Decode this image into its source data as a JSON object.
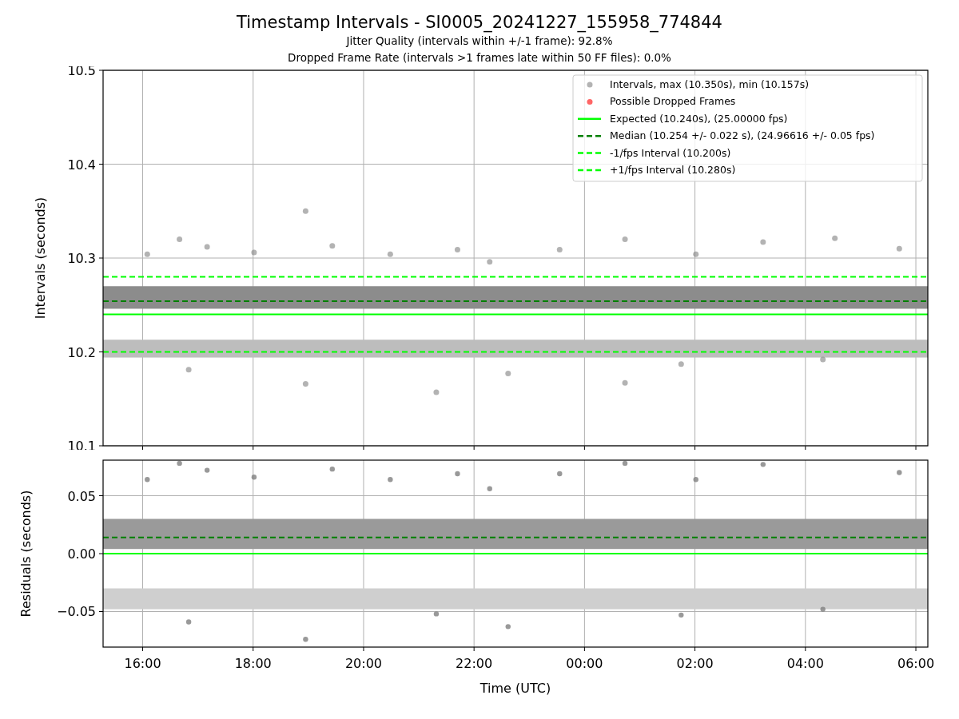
{
  "title": "Timestamp Intervals - SI0005_20241227_155958_774844",
  "subtitles": [
    "Jitter Quality (intervals within +/-1 frame): 92.8%",
    "Dropped Frame Rate (intervals >1 frames late within 50 FF files): 0.0%"
  ],
  "intervals_plot": {
    "chart_data": {
      "type": "scatter",
      "ylabel": "Intervals (seconds)",
      "grid": true,
      "legend": true,
      "xlim": [
        "2024-12-27T15:17",
        "2024-12-28T06:13"
      ],
      "ylim": [
        10.1,
        10.5
      ],
      "yticks": [
        {
          "value": 10.1,
          "label": "10.1"
        },
        {
          "value": 10.2,
          "label": "10.2"
        },
        {
          "value": 10.3,
          "label": "10.3"
        },
        {
          "value": 10.4,
          "label": "10.4"
        },
        {
          "value": 10.5,
          "label": "10.5"
        }
      ],
      "bands": [
        {
          "axis": "y",
          "from": 10.246,
          "to": 10.27,
          "color": "#8c8c8c"
        },
        {
          "axis": "y",
          "from": 10.194,
          "to": 10.213,
          "color": "#bdbdbd"
        }
      ],
      "series": [
        {
          "name": "Intervals, max (10.350s), min (10.157s)",
          "type": "scatter",
          "color": "#808080",
          "x": [
            "2024-12-27T16:05",
            "2024-12-27T16:40",
            "2024-12-27T17:10",
            "2024-12-27T18:01",
            "2024-12-27T18:57",
            "2024-12-27T19:26",
            "2024-12-27T20:29",
            "2024-12-27T21:42",
            "2024-12-27T22:17",
            "2024-12-27T23:33",
            "2024-12-28T00:44",
            "2024-12-28T02:01",
            "2024-12-28T03:14",
            "2024-12-28T04:32",
            "2024-12-28T05:42",
            "2024-12-27T16:50",
            "2024-12-27T18:57",
            "2024-12-27T21:19",
            "2024-12-27T22:37",
            "2024-12-28T00:44",
            "2024-12-28T01:45",
            "2024-12-28T04:19"
          ],
          "values": [
            10.304,
            10.32,
            10.312,
            10.306,
            10.35,
            10.313,
            10.304,
            10.309,
            10.296,
            10.309,
            10.32,
            10.304,
            10.317,
            10.321,
            10.31,
            10.181,
            10.166,
            10.157,
            10.177,
            10.167,
            10.187,
            10.192
          ]
        },
        {
          "name": "Possible Dropped Frames",
          "type": "scatter",
          "color": "#ff0000"
        },
        {
          "name": "Expected (10.240s), (25.00000 fps)",
          "type": "line",
          "line_style": "solid",
          "color": "#00ff00",
          "x": [
            "2024-12-27T15:17",
            "2024-12-28T06:13"
          ],
          "values": [
            10.24,
            10.24
          ]
        },
        {
          "name": "Median (10.254 +/- 0.022 s), (24.96616 +/- 0.05 fps)",
          "type": "line",
          "line_style": "dashed",
          "color": "#008000",
          "x": [
            "2024-12-27T15:17",
            "2024-12-28T06:13"
          ],
          "values": [
            10.254,
            10.254
          ]
        },
        {
          "name": "-1/fps Interval (10.200s)",
          "type": "line",
          "line_style": "dashed",
          "color": "#00ff00",
          "x": [
            "2024-12-27T15:17",
            "2024-12-28T06:13"
          ],
          "values": [
            10.2,
            10.2
          ]
        },
        {
          "name": "+1/fps Interval (10.280s)",
          "type": "line",
          "line_style": "dashed",
          "color": "#00ff00",
          "x": [
            "2024-12-27T15:17",
            "2024-12-28T06:13"
          ],
          "values": [
            10.28,
            10.28
          ]
        }
      ]
    }
  },
  "residuals_plot": {
    "chart_data": {
      "type": "scatter",
      "xlabel": "Time (UTC)",
      "ylabel": "Residuals (seconds)",
      "grid": true,
      "xlim": [
        "2024-12-27T15:17",
        "2024-12-28T06:13"
      ],
      "ylim": [
        -0.0807,
        0.0807
      ],
      "xticks": [
        {
          "value": "2024-12-27T16:00",
          "label": "16:00"
        },
        {
          "value": "2024-12-27T18:00",
          "label": "18:00"
        },
        {
          "value": "2024-12-27T20:00",
          "label": "20:00"
        },
        {
          "value": "2024-12-27T22:00",
          "label": "22:00"
        },
        {
          "value": "2024-12-28T00:00",
          "label": "00:00"
        },
        {
          "value": "2024-12-28T02:00",
          "label": "02:00"
        },
        {
          "value": "2024-12-28T04:00",
          "label": "04:00"
        },
        {
          "value": "2024-12-28T06:00",
          "label": "06:00"
        }
      ],
      "yticks": [
        {
          "value": -0.05,
          "label": "−0.05"
        },
        {
          "value": 0,
          "label": "0.00"
        },
        {
          "value": 0.05,
          "label": "0.05"
        }
      ],
      "bands": [
        {
          "axis": "y",
          "from": 0.004,
          "to": 0.03,
          "color": "#9a9a9a"
        },
        {
          "axis": "y",
          "from": -0.048,
          "to": -0.03,
          "color": "#cfcfcf"
        }
      ],
      "series": [
        {
          "type": "scatter",
          "color": "#808080",
          "x": [
            "2024-12-27T16:05",
            "2024-12-27T16:40",
            "2024-12-27T17:10",
            "2024-12-27T18:01",
            "2024-12-27T19:26",
            "2024-12-27T20:29",
            "2024-12-27T21:42",
            "2024-12-27T22:17",
            "2024-12-27T23:33",
            "2024-12-28T00:44",
            "2024-12-28T02:01",
            "2024-12-28T03:14",
            "2024-12-28T05:42",
            "2024-12-27T16:50",
            "2024-12-27T18:57",
            "2024-12-27T21:19",
            "2024-12-27T22:37",
            "2024-12-28T01:45",
            "2024-12-28T04:19"
          ],
          "values": [
            0.064,
            0.078,
            0.072,
            0.066,
            0.073,
            0.064,
            0.069,
            0.056,
            0.069,
            0.078,
            0.064,
            0.077,
            0.07,
            -0.059,
            -0.074,
            -0.052,
            -0.063,
            -0.053,
            -0.048
          ]
        },
        {
          "type": "line",
          "line_style": "solid",
          "color": "#00ff00",
          "x": [
            "2024-12-27T15:17",
            "2024-12-28T06:13"
          ],
          "values": [
            0,
            0
          ]
        },
        {
          "type": "line",
          "line_style": "dashed",
          "color": "#008000",
          "x": [
            "2024-12-27T15:17",
            "2024-12-28T06:13"
          ],
          "values": [
            0.014,
            0.014
          ]
        }
      ]
    }
  }
}
